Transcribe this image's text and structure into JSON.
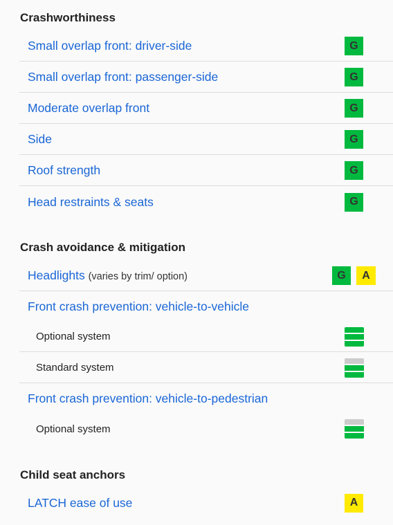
{
  "sections": [
    {
      "title": "Crashworthiness",
      "rows": [
        {
          "label": "Small overlap front: driver-side",
          "rating": "G"
        },
        {
          "label": "Small overlap front: passenger-side",
          "rating": "G"
        },
        {
          "label": "Moderate overlap front",
          "rating": "G"
        },
        {
          "label": "Side",
          "rating": "G"
        },
        {
          "label": "Roof strength",
          "rating": "G"
        },
        {
          "label": "Head restraints & seats",
          "rating": "G"
        }
      ]
    },
    {
      "title": "Crash avoidance & mitigation",
      "headlights": {
        "label": "Headlights",
        "note": "(varies by trim/ option)",
        "ratings": [
          "G",
          "A"
        ]
      },
      "fcp_vehicle": {
        "label": "Front crash prevention: vehicle-to-vehicle",
        "systems": [
          {
            "label": "Optional system",
            "level": "3 of 3"
          },
          {
            "label": "Standard system",
            "level": "2 of 3"
          }
        ]
      },
      "fcp_pedestrian": {
        "label": "Front crash prevention: vehicle-to-pedestrian",
        "systems": [
          {
            "label": "Optional system",
            "level": "2 of 3"
          }
        ]
      }
    },
    {
      "title": "Child seat anchors",
      "rows": [
        {
          "label": "LATCH ease of use",
          "rating": "A"
        }
      ]
    }
  ],
  "colors": {
    "good": "#00b93e",
    "acceptable": "#ffea00",
    "link": "#1a66d6",
    "inactive_bar": "#cccccc"
  }
}
